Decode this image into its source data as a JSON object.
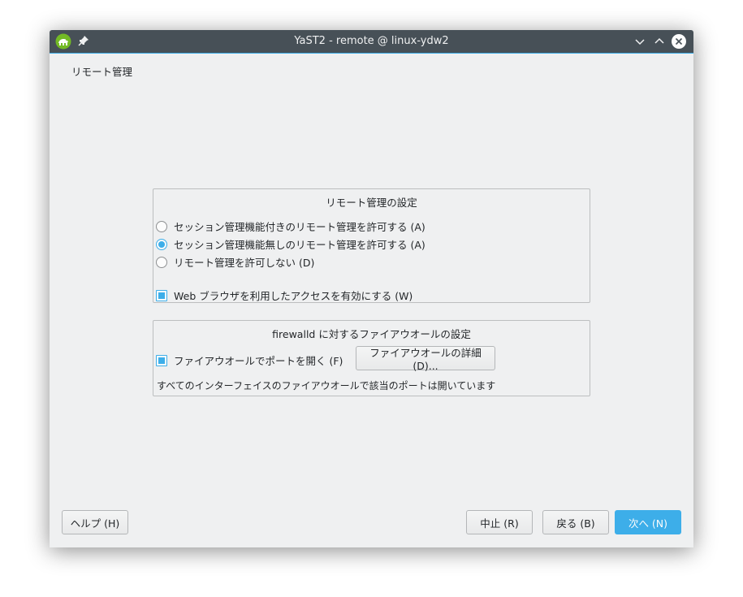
{
  "window": {
    "title": "YaST2 - remote @ linux-ydw2"
  },
  "page": {
    "title": "リモート管理"
  },
  "remote_settings": {
    "title": "リモート管理の設定",
    "options": [
      {
        "label": "セッション管理機能付きのリモート管理を許可する (A)",
        "selected": false
      },
      {
        "label": "セッション管理機能無しのリモート管理を許可する (A)",
        "selected": true
      },
      {
        "label": "リモート管理を許可しない (D)",
        "selected": false
      }
    ],
    "web_access": {
      "label": "Web ブラウザを利用したアクセスを有効にする (W)",
      "checked": true
    }
  },
  "firewall": {
    "title": "firewalld に対するファイアウオールの設定",
    "open_port": {
      "label": "ファイアウオールでポートを開く (F)",
      "checked": true
    },
    "details_button": "ファイアウオールの詳細 (D)...",
    "status": "すべてのインターフェイスのファイアウオールで該当のポートは開いています"
  },
  "buttons": {
    "help": "ヘルプ (H)",
    "abort": "中止 (R)",
    "back": "戻る (B)",
    "next": "次へ (N)"
  },
  "colors": {
    "accent": "#3daee9",
    "titlebar": "#475057",
    "background": "#eff0f1"
  }
}
